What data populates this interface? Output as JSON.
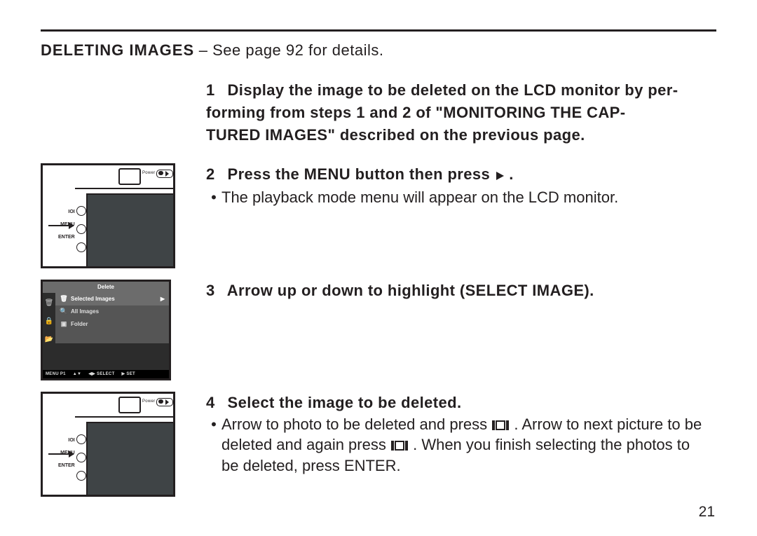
{
  "rule": true,
  "heading": {
    "bold": "DELETING IMAGES",
    "rest": " – See page 92 for details."
  },
  "step1": {
    "num": "1",
    "line1a": "Display the image to be deleted on the LCD monitor by per-",
    "line2a": "forming from steps ",
    "line2num1": "1",
    "line2mid": " and ",
    "line2num2": "2",
    "line2b": " of \"MONITORING THE CAP-",
    "line3": "TURED IMAGES\" described on the previous page."
  },
  "step2": {
    "num": "2",
    "text_before": "Press the MENU button then press ",
    "text_after": " .",
    "bullet": "The playback mode menu will appear on the LCD monitor."
  },
  "step3": {
    "num": "3",
    "text": "Arrow up or down to highlight (SELECT IMAGE)."
  },
  "step4": {
    "num": "4",
    "text": "Select the image to be deleted.",
    "bullet_a": "Arrow to photo to be deleted and press ",
    "bullet_b": " . Arrow to next picture to be",
    "bullet_c": "deleted and again press ",
    "bullet_d": " . When you finish selecting the photos to",
    "bullet_e": "be deleted, press ENTER."
  },
  "cam_labels": {
    "power": "Power",
    "l1": "IOI",
    "l2": "MENU",
    "l3": "ENTER"
  },
  "menu_thumb": {
    "title": "Delete",
    "items": [
      {
        "icon": "🗑",
        "label": "Selected Images"
      },
      {
        "icon": "🔍",
        "label": "All Images"
      },
      {
        "icon": "▣",
        "label": "Folder"
      }
    ],
    "tabs": [
      "🗑",
      "🔒",
      "📂"
    ],
    "footer": {
      "a": "MENU P1",
      "b": "▲▼",
      "c": "◀▶ SELECT",
      "d": "▶ SET"
    }
  },
  "page_number": "21"
}
